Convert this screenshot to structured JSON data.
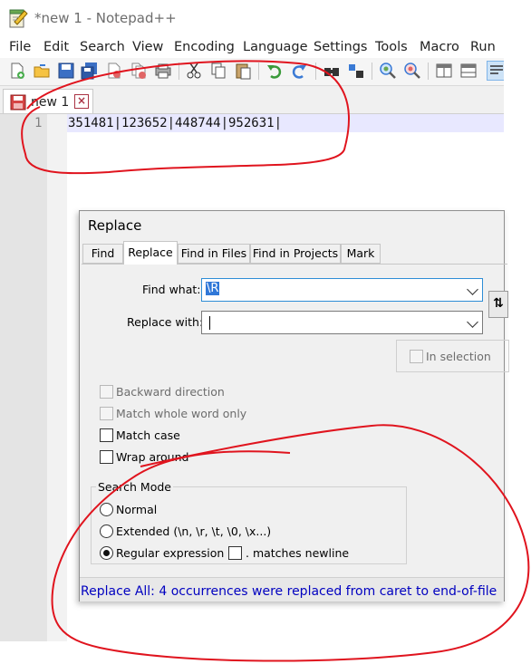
{
  "window": {
    "title": "*new 1 - Notepad++",
    "app_icon": "notepad-icon"
  },
  "menu": [
    "File",
    "Edit",
    "Search",
    "View",
    "Encoding",
    "Language",
    "Settings",
    "Tools",
    "Macro",
    "Run"
  ],
  "toolbar": {
    "icons": [
      "new-file-icon",
      "open-file-icon",
      "save-icon",
      "save-all-icon",
      "close-icon",
      "close-all-icon",
      "print-icon",
      "cut-icon",
      "copy-icon",
      "paste-icon",
      "undo-icon",
      "redo-icon",
      "find-icon",
      "replace-icon",
      "zoom-in-icon",
      "zoom-out-icon",
      "sync-vertical-icon",
      "sync-horizontal-icon",
      "word-wrap-icon"
    ]
  },
  "tabs": [
    {
      "label": "new 1",
      "icon": "unsaved-file-icon",
      "close_icon": "close-tab-icon"
    }
  ],
  "editor": {
    "line_number": "1",
    "line_text": "351481|123652|448744|952631|"
  },
  "replace_dialog": {
    "title": "Replace",
    "tabs": [
      "Find",
      "Replace",
      "Find in Files",
      "Find in Projects",
      "Mark"
    ],
    "active_tab": "Replace",
    "find_label": "Find what:",
    "find_value": "\\R",
    "replace_label": "Replace with:",
    "replace_value": "",
    "swap_icon": "swap-icon",
    "in_selection_label": "In selection",
    "options": {
      "backward": "Backward direction",
      "whole_word": "Match whole word only",
      "match_case": "Match case",
      "wrap_around": "Wrap around"
    },
    "search_mode": {
      "legend": "Search Mode",
      "normal": "Normal",
      "extended": "Extended (\\n, \\r, \\t, \\0, \\x...)",
      "regex": "Regular expression",
      "matches_newline": ". matches newline",
      "selected": "Regular expression"
    },
    "status": "Replace All: 4 occurrences were replaced from caret to end-of-file"
  },
  "colors": {
    "annotation": "#e0141e",
    "status_text": "#0000c0",
    "selection": "#3078d8"
  }
}
